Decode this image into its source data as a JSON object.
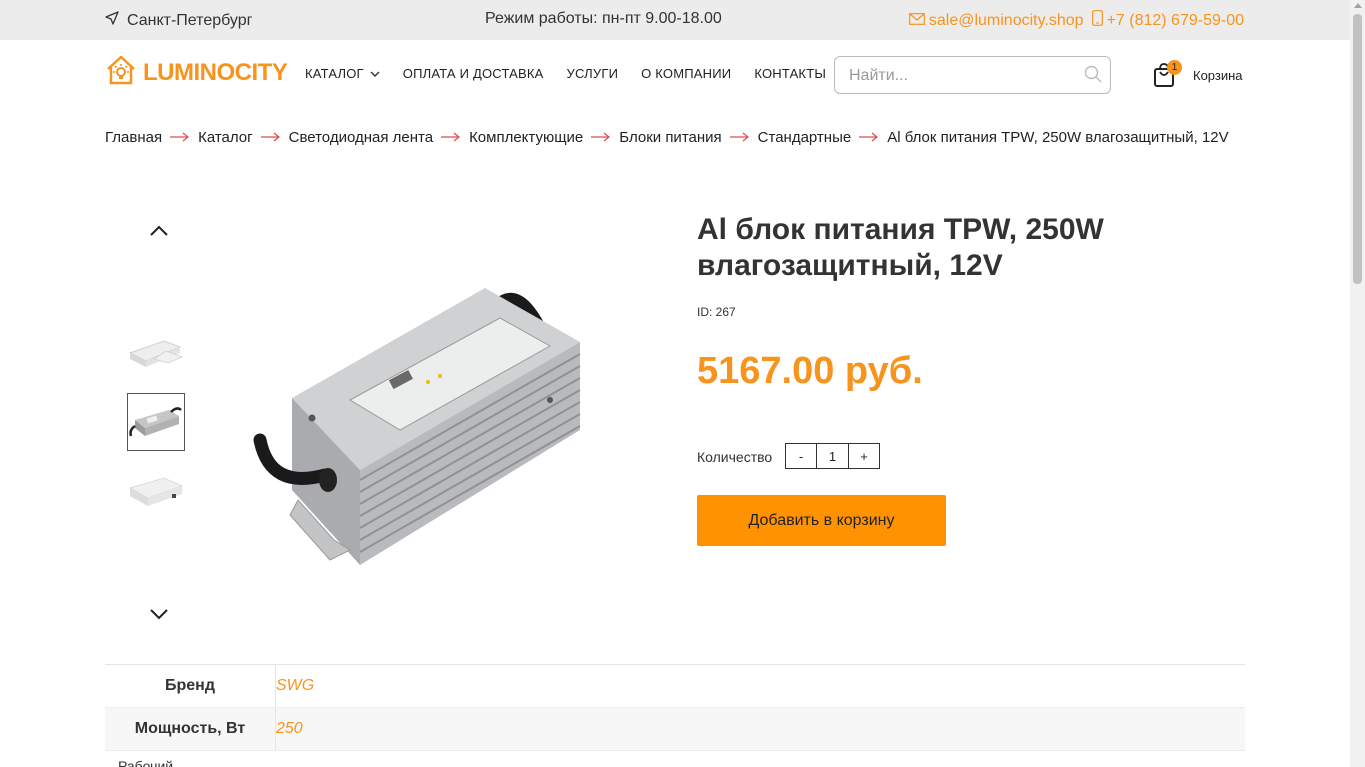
{
  "topbar": {
    "city": "Санкт-Петербург",
    "hours": "Режим работы: пн-пт 9.00-18.00",
    "email": "sale@luminocity.shop",
    "phone": "+7 (812) 679-59-00"
  },
  "header": {
    "logo_text": "LUMINOCITY",
    "nav": [
      "КАТАЛОГ",
      "ОПЛАТА И ДОСТАВКА",
      "УСЛУГИ",
      "О КОМПАНИИ",
      "КОНТАКТЫ"
    ],
    "search_placeholder": "Найти...",
    "cart_count": "1",
    "cart_label": "Корзина"
  },
  "breadcrumb": [
    "Главная",
    "Каталог",
    "Светодиодная лента",
    "Комплектующие",
    "Блоки питания",
    "Стандартные",
    "Al блок питания TPW, 250W влагозащитный, 12V"
  ],
  "product": {
    "title": "Al блок питания TPW, 250W влагозащитный, 12V",
    "id_text": "ID: 267",
    "price": "5167.00 руб.",
    "qty_label": "Количество",
    "qty_minus": "-",
    "qty_value": "1",
    "qty_plus": "+",
    "add_to_cart": "Добавить в корзину"
  },
  "specs": [
    {
      "key": "Бренд",
      "value": "SWG"
    },
    {
      "key": "Мощность, Вт",
      "value": "250"
    }
  ],
  "spec_cut": "Рабочий",
  "colors": {
    "accent": "#f7941d",
    "button": "#ff9200"
  }
}
